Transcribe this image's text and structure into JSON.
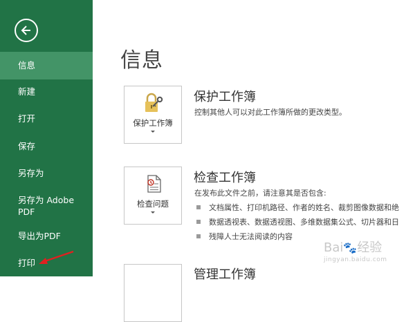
{
  "sidebar": {
    "items": [
      {
        "label": "信息"
      },
      {
        "label": "新建"
      },
      {
        "label": "打开"
      },
      {
        "label": "保存"
      },
      {
        "label": "另存为"
      },
      {
        "label_line1": "另存为 Adobe",
        "label_line2": "PDF"
      },
      {
        "label": "导出为PDF"
      },
      {
        "label": "打印"
      }
    ],
    "active_index": 0,
    "background_color": "#217346",
    "active_color": "#439467"
  },
  "main": {
    "title": "信息",
    "sections": [
      {
        "button_label": "保护工作簿",
        "button_icon": "lock-key-icon",
        "title": "保护工作簿",
        "description": "控制其他人可以对此工作簿所做的更改类型。"
      },
      {
        "button_label": "检查问题",
        "button_icon": "document-check-icon",
        "title": "检查工作簿",
        "description": "在发布此文件之前，请注意其是否包含:",
        "bullets": [
          "文档属性、打印机路径、作者的姓名、裁剪图像数据和绝",
          "数据透视表、数据透视图、多维数据集公式、切片器和日",
          "残障人士无法阅读的内容"
        ]
      },
      {
        "title": "管理工作簿"
      }
    ]
  },
  "watermark": {
    "text": "Bai",
    "text2": "经验",
    "sub": "jingyan.baidu.com"
  },
  "colors": {
    "accent": "#217346",
    "annotation_arrow": "#e02020"
  }
}
